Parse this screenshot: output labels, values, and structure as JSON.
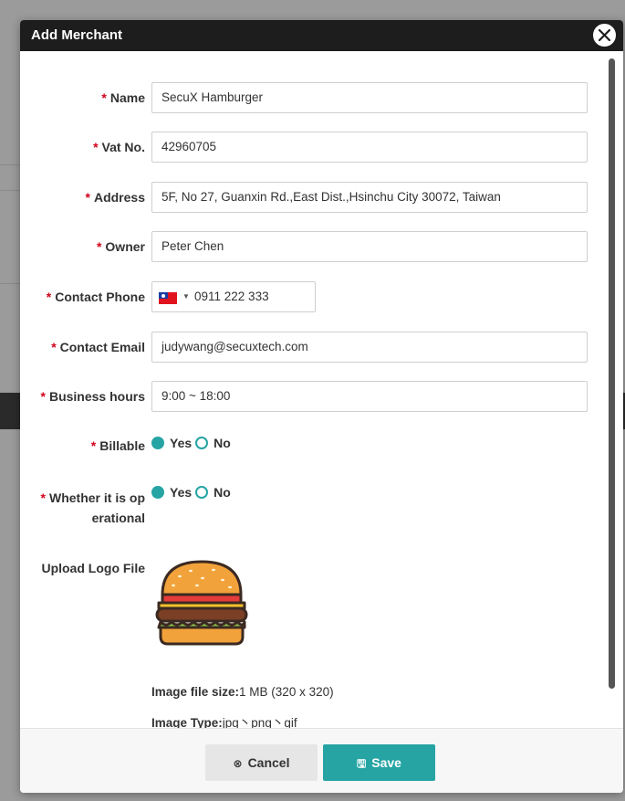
{
  "modal": {
    "title": "Add Merchant",
    "close_icon": "close-icon"
  },
  "form": {
    "required_mark": "*",
    "name": {
      "label": "Name",
      "value": "SecuX Hamburger"
    },
    "vat": {
      "label": "Vat No.",
      "value": "42960705"
    },
    "address": {
      "label": "Address",
      "value": "5F, No 27, Guanxin Rd.,East Dist.,Hsinchu City 30072, Taiwan"
    },
    "owner": {
      "label": "Owner",
      "value": "Peter Chen"
    },
    "phone": {
      "label": "Contact Phone",
      "value": "0911 222 333",
      "country_flag": "taiwan-flag-icon"
    },
    "email": {
      "label": "Contact Email",
      "value": "judywang@secuxtech.com"
    },
    "hours": {
      "label": "Business hours",
      "value": "9:00 ~ 18:00"
    },
    "billable": {
      "label": "Billable",
      "yes": "Yes",
      "no": "No",
      "selected": "Yes"
    },
    "operational": {
      "label": "Whether it is op erational",
      "yes": "Yes",
      "no": "No",
      "selected": "Yes"
    },
    "logo": {
      "label": "Upload Logo File",
      "size_key": "Image file size:",
      "size_val": "1 MB (320 x 320)",
      "type_key": "Image Type:",
      "type_val": "jpg丶png丶gif"
    }
  },
  "footer": {
    "cancel_label": "Cancel",
    "save_label": "Save"
  },
  "colors": {
    "accent": "#26a4a4",
    "header": "#1d1d1d",
    "required": "#d0021b"
  }
}
